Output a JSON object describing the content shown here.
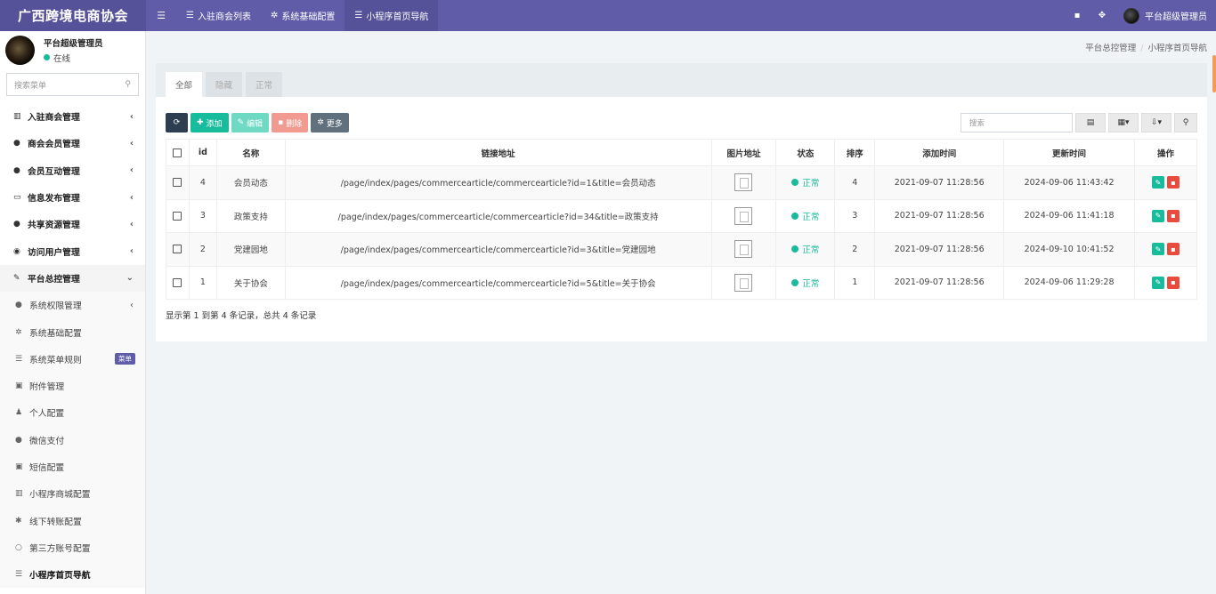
{
  "app": {
    "title": "广西跨境电商协会"
  },
  "topnav": {
    "tabs": [
      {
        "label": "入驻商会列表",
        "icon": "list-icon"
      },
      {
        "label": "系统基础配置",
        "icon": "gear-icon"
      },
      {
        "label": "小程序首页导航",
        "icon": "list-icon"
      }
    ],
    "user": "平台超级管理员"
  },
  "sidebar": {
    "user_name": "平台超级管理员",
    "status": "在线",
    "search_placeholder": "搜索菜单",
    "items": [
      {
        "label": "入驻商会管理"
      },
      {
        "label": "商会会员管理"
      },
      {
        "label": "会员互动管理"
      },
      {
        "label": "信息发布管理"
      },
      {
        "label": "共享资源管理"
      },
      {
        "label": "访问用户管理"
      },
      {
        "label": "平台总控管理"
      }
    ],
    "subitems": [
      {
        "label": "系统权限管理"
      },
      {
        "label": "系统基础配置"
      },
      {
        "label": "系统菜单规则",
        "badge": "菜单"
      },
      {
        "label": "附件管理"
      },
      {
        "label": "个人配置"
      },
      {
        "label": "微信支付"
      },
      {
        "label": "短信配置"
      },
      {
        "label": "小程序商城配置"
      },
      {
        "label": "线下转账配置"
      },
      {
        "label": "第三方账号配置"
      },
      {
        "label": "小程序首页导航"
      }
    ]
  },
  "breadcrumb": {
    "parent": "平台总控管理",
    "current": "小程序首页导航"
  },
  "tabs": [
    "全部",
    "隐藏",
    "正常"
  ],
  "toolbar": {
    "add": "添加",
    "edit": "编辑",
    "delete": "删除",
    "more": "更多",
    "search_placeholder": "搜索"
  },
  "table": {
    "headers": {
      "id": "id",
      "name": "名称",
      "url": "链接地址",
      "image": "图片地址",
      "status": "状态",
      "sort": "排序",
      "created": "添加时间",
      "updated": "更新时间",
      "ops": "操作"
    },
    "rows": [
      {
        "id": "4",
        "name": "会员动态",
        "url": "/page/index/pages/commercearticle/commercearticle?id=1&title=会员动态",
        "status": "正常",
        "sort": "4",
        "created": "2021-09-07 11:28:56",
        "updated": "2024-09-06 11:43:42"
      },
      {
        "id": "3",
        "name": "政策支持",
        "url": "/page/index/pages/commercearticle/commercearticle?id=34&title=政策支持",
        "status": "正常",
        "sort": "3",
        "created": "2021-09-07 11:28:56",
        "updated": "2024-09-06 11:41:18"
      },
      {
        "id": "2",
        "name": "党建园地",
        "url": "/page/index/pages/commercearticle/commercearticle?id=3&title=党建园地",
        "status": "正常",
        "sort": "2",
        "created": "2021-09-07 11:28:56",
        "updated": "2024-09-10 10:41:52"
      },
      {
        "id": "1",
        "name": "关于协会",
        "url": "/page/index/pages/commercearticle/commercearticle?id=5&title=关于协会",
        "status": "正常",
        "sort": "1",
        "created": "2021-09-07 11:28:56",
        "updated": "2024-09-06 11:29:28"
      }
    ]
  },
  "pagination": {
    "info": "显示第 1 到第 4 条记录，总共 4 条记录"
  }
}
